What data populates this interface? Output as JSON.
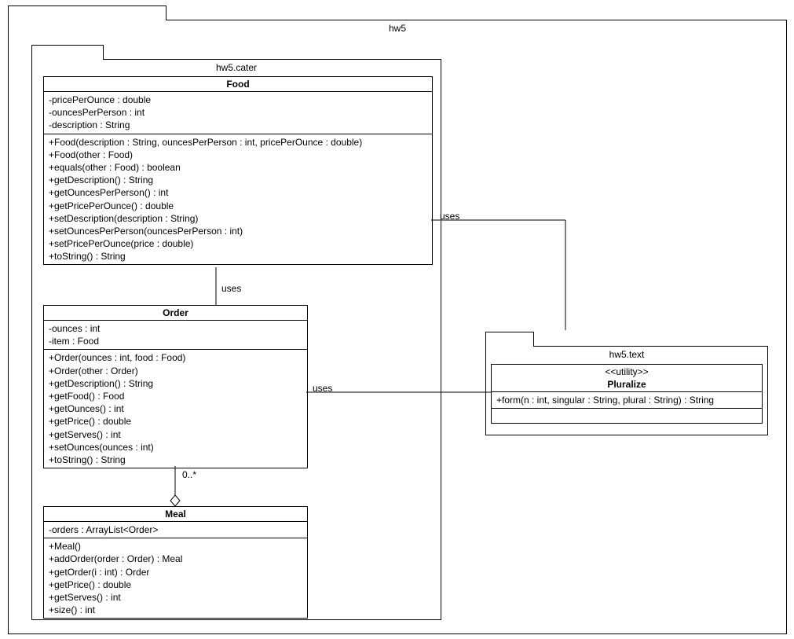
{
  "outerPackage": {
    "title": "hw5"
  },
  "caterPackage": {
    "title": "hw5.cater"
  },
  "textPackage": {
    "title": "hw5.text"
  },
  "food": {
    "name": "Food",
    "attrs": [
      "-pricePerOunce : double",
      "-ouncesPerPerson : int",
      "-description : String"
    ],
    "ops": [
      "+Food(description : String, ouncesPerPerson : int, pricePerOunce : double)",
      "+Food(other : Food)",
      "+equals(other : Food) : boolean",
      "+getDescription() : String",
      "+getOuncesPerPerson() : int",
      "+getPricePerOunce() : double",
      "+setDescription(description : String)",
      "+setOuncesPerPerson(ouncesPerPerson : int)",
      "+setPricePerOunce(price : double)",
      "+toString() : String"
    ]
  },
  "order": {
    "name": "Order",
    "attrs": [
      "-ounces : int",
      "-item : Food"
    ],
    "ops": [
      "+Order(ounces : int, food : Food)",
      "+Order(other : Order)",
      "+getDescription() : String",
      "+getFood() : Food",
      "+getOunces() : int",
      "+getPrice() : double",
      "+getServes() : int",
      "+setOunces(ounces : int)",
      "+toString() : String"
    ]
  },
  "meal": {
    "name": "Meal",
    "attrs": [
      "-orders : ArrayList<Order>"
    ],
    "ops": [
      "+Meal()",
      "+addOrder(order : Order) : Meal",
      "+getOrder(i : int) : Order",
      "+getPrice() : double",
      "+getServes() : int",
      "+size() : int"
    ]
  },
  "pluralize": {
    "stereotype": "<<utility>>",
    "name": "Pluralize",
    "ops": [
      "+form(n : int, singular : String, plural : String) : String"
    ]
  },
  "labels": {
    "usesFoodOrder": "uses",
    "usesFoodPluralize": "uses",
    "usesOrderPluralize": "uses",
    "multiplicity": "0..*"
  }
}
